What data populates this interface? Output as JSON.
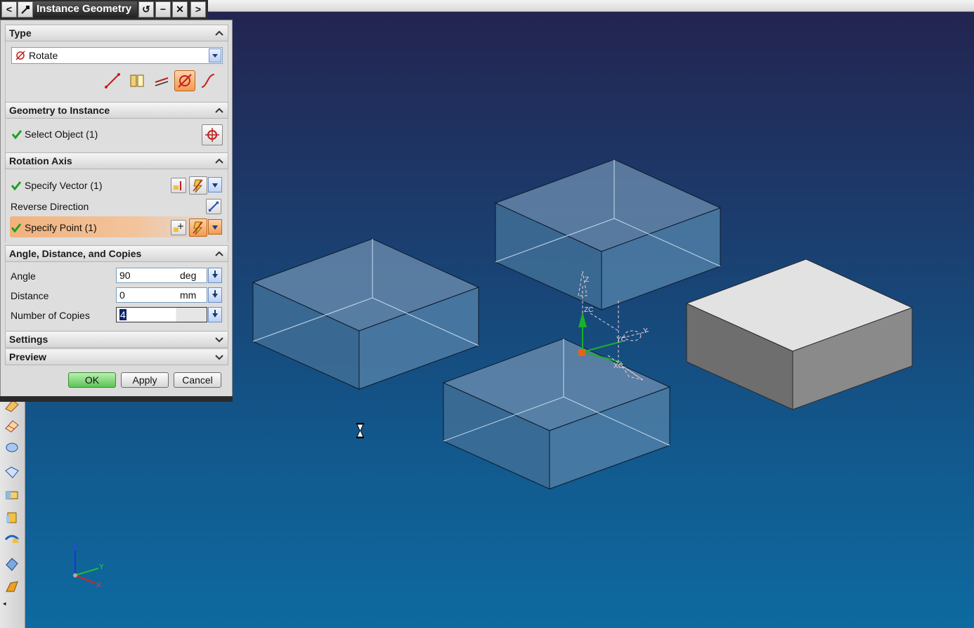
{
  "dialog": {
    "title": "Instance Geometry",
    "tab_buttons": {
      "prev": "<",
      "next": ">",
      "pin": "pin-icon",
      "reset": "reset-icon",
      "minimize": "minimize-icon",
      "close": "close-icon"
    },
    "type_section": {
      "header": "Type",
      "selected": "Rotate",
      "type_icons": [
        "line-icon",
        "mirror-icon",
        "translate-icon",
        "rotate-icon",
        "curve-icon"
      ],
      "active_icon": "rotate-icon"
    },
    "geometry_section": {
      "header": "Geometry to Instance",
      "select_object": "Select Object (1)"
    },
    "axis_section": {
      "header": "Rotation Axis",
      "specify_vector": "Specify Vector (1)",
      "reverse_direction": "Reverse Direction",
      "specify_point": "Specify Point (1)"
    },
    "angle_section": {
      "header": "Angle, Distance, and Copies",
      "angle_label": "Angle",
      "angle_value": "90",
      "angle_unit": "deg",
      "distance_label": "Distance",
      "distance_value": "0",
      "distance_unit": "mm",
      "copies_label": "Number of Copies",
      "copies_value": "4"
    },
    "settings_header": "Settings",
    "preview_header": "Preview",
    "buttons": {
      "ok": "OK",
      "apply": "Apply",
      "cancel": "Cancel"
    }
  },
  "viewport": {
    "csys_labels": {
      "z": "Z",
      "y": "Y",
      "x": "X"
    },
    "dynamic_csys_labels": {
      "zc": "ZC",
      "yc": "YC",
      "xc": "XC",
      "z": "Z",
      "y": "Y"
    },
    "background_top": "#232450",
    "background_bottom": "#0e6aa0"
  }
}
